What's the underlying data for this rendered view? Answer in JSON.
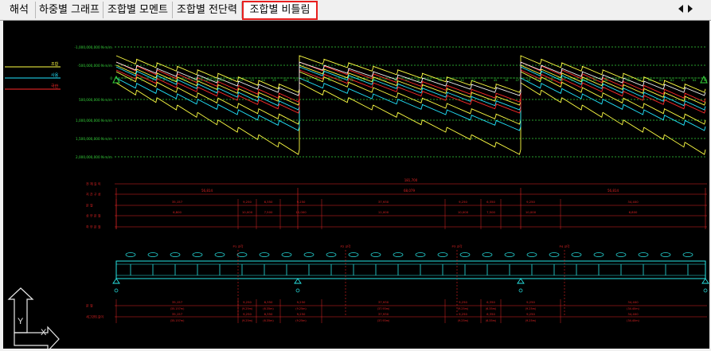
{
  "tabs": [
    {
      "label": "해석",
      "active": false
    },
    {
      "label": "하중별 그래프",
      "active": false
    },
    {
      "label": "조합별 모멘트",
      "active": false
    },
    {
      "label": "조합별 전단력",
      "active": false
    },
    {
      "label": "조합별 비틀림",
      "active": true
    }
  ],
  "nav": {
    "prev_icon": "triangle-left-icon",
    "next_icon": "triangle-right-icon"
  },
  "colors": {
    "background": "#000000",
    "grid": "#35d23a",
    "envelope": "#ffff44",
    "mean": "#22e6ff",
    "service": "#ff2a2a",
    "combo_white": "#f4f4f4",
    "girder": "#28e6e6",
    "dimension": "#e32424"
  },
  "legend": {
    "items": [
      {
        "label": "조합",
        "color": "#ffff44"
      },
      {
        "label": "사용",
        "color": "#22e6ff"
      },
      {
        "label": "극한",
        "color": "#ff2a2a"
      }
    ]
  },
  "chart": {
    "y_tick_labels": [
      "-1,000,000,000 N·m/m",
      "-500,000,000 N·m/m",
      "0",
      "500,000,000 N·m/m",
      "1,000,000,000 N·m/m",
      "1,500,000,000 N·m/m",
      "2,000,000,000 N·m/m"
    ],
    "node_labels": [
      "1",
      "3",
      "5",
      "7",
      "9",
      "1011",
      "12",
      "131415",
      "1617",
      "181920",
      "21",
      "22",
      "23",
      "24",
      "25",
      "26",
      "27",
      "28",
      "29",
      "30",
      "31",
      "32",
      "33",
      "34",
      "35",
      "36",
      "37",
      "38",
      "39",
      "40",
      "41",
      "42",
      "43",
      "44",
      "45",
      "46",
      "47",
      "48",
      "49",
      "50",
      "51",
      "52",
      "5354",
      "55",
      "56",
      "57",
      "58",
      "59",
      "60",
      "61",
      "62",
      "63",
      "64",
      "65"
    ]
  },
  "dimension_table": {
    "row_labels": [
      "전 체 길 이",
      "지 간 구 성",
      "분 절",
      "상 부 분 절",
      "하 부 분 절"
    ],
    "total_length": "181,700",
    "span_lengths": [
      "56,814",
      "68,079",
      "56,814"
    ],
    "segment_lengths": [
      "35,157",
      "9,250",
      "6,350",
      "9,250",
      "37,930",
      "9,250",
      "6,350",
      "9,250",
      "34,400"
    ],
    "segment_sub": [
      "6,800",
      "10,000",
      "7,500",
      "10,000",
      "11,000",
      "10,000",
      "7,500",
      "10,000",
      "6,800"
    ]
  },
  "girder": {
    "pier_labels": [
      "P1 교각",
      "P2 교각",
      "P3 교각",
      "P4 교각"
    ],
    "bottom_dims": [
      "35,157",
      "9,250",
      "6,350",
      "9,250",
      "37,930",
      "9,250",
      "6,350",
      "9,250",
      "34,400"
    ],
    "bottom_dims_sub": [
      "(35.157m)",
      "(9.25m)",
      "(6.35m)",
      "(9.25m)",
      "(37.93m)",
      "(9.25m)",
      "(6.35m)",
      "(9.25m)",
      "(34.40m)"
    ],
    "row_labels": [
      "분 절",
      "세그먼트길이"
    ]
  },
  "axis_icon": {
    "x_label": "X",
    "y_label": "Y"
  }
}
